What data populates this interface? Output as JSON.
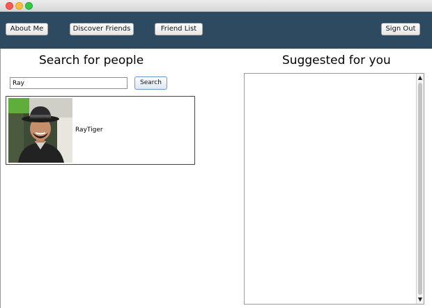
{
  "nav": {
    "about": "About Me",
    "discover": "Discover Friends",
    "friends": "Friend List",
    "signout": "Sign Out"
  },
  "search": {
    "heading": "Search for people",
    "query": "Ray",
    "button": "Search",
    "results": [
      {
        "name": "RayTiger",
        "avatar_icon": "person-photo"
      }
    ]
  },
  "suggested": {
    "heading": "Suggested for you",
    "items": []
  },
  "colors": {
    "navbar": "#2e4a61",
    "search_button_border": "#6d97c9"
  }
}
